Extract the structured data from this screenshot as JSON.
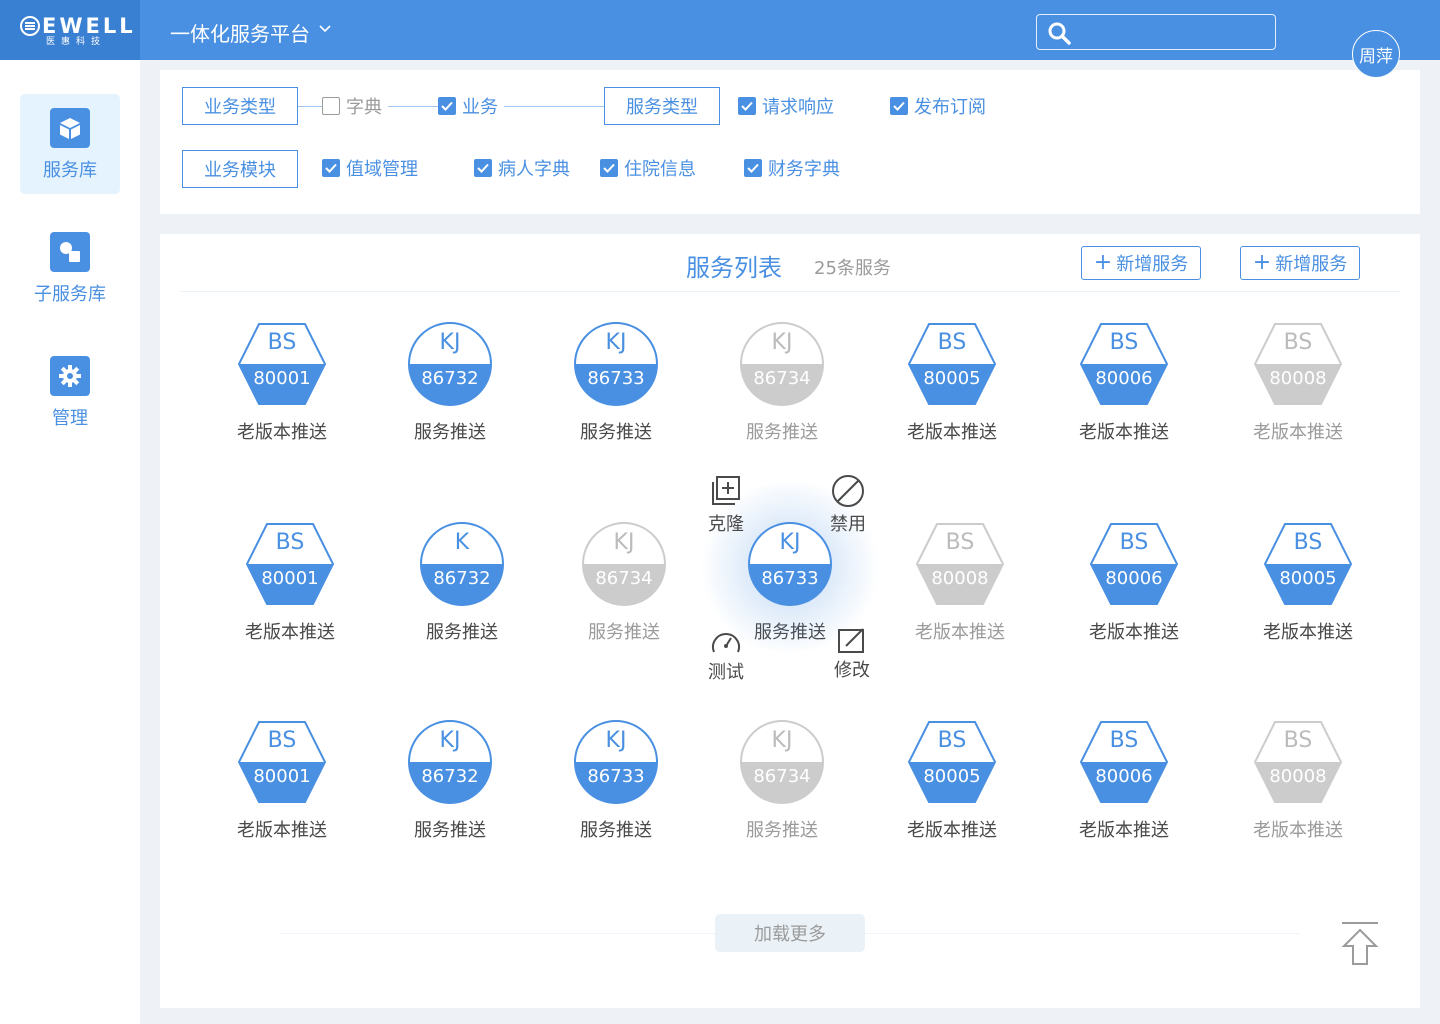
{
  "brand": {
    "logo_text": "EWELL",
    "logo_sub": "医惠科技",
    "color": "#4A90E2"
  },
  "header": {
    "title": "一体化服务平台",
    "user": "周萍"
  },
  "sidebar": {
    "items": [
      {
        "label": "服务库",
        "icon": "box-icon",
        "active": true
      },
      {
        "label": "子服务库",
        "icon": "shapes-icon",
        "active": false
      },
      {
        "label": "管理",
        "icon": "gear-icon",
        "active": false
      }
    ]
  },
  "filters": {
    "row1": {
      "tag1": "业务类型",
      "opt_dict": "字典",
      "opt_business": "业务",
      "tag2": "服务类型",
      "opt_request": "请求响应",
      "opt_publish": "发布订阅"
    },
    "row2": {
      "tag": "业务模块",
      "opt_domain": "值域管理",
      "opt_patient": "病人字典",
      "opt_inpatient": "住院信息",
      "opt_finance": "财务字典"
    }
  },
  "list": {
    "title": "服务列表",
    "count": "25条服务",
    "add_label_1": "新增服务",
    "add_label_2": "新增服务",
    "load_more": "加载更多"
  },
  "actions": {
    "clone": "克隆",
    "disable": "禁用",
    "test": "测试",
    "edit": "修改"
  },
  "services": [
    {
      "shape": "hex",
      "code": "BS",
      "num": "80001",
      "name": "老版本推送",
      "disabled": false
    },
    {
      "shape": "circle",
      "code": "KJ",
      "num": "86732",
      "name": "服务推送",
      "disabled": false
    },
    {
      "shape": "circle",
      "code": "KJ",
      "num": "86733",
      "name": "服务推送",
      "disabled": false
    },
    {
      "shape": "circle",
      "code": "KJ",
      "num": "86734",
      "name": "服务推送",
      "disabled": true
    },
    {
      "shape": "hex",
      "code": "BS",
      "num": "80005",
      "name": "老版本推送",
      "disabled": false
    },
    {
      "shape": "hex",
      "code": "BS",
      "num": "80006",
      "name": "老版本推送",
      "disabled": false
    },
    {
      "shape": "hex",
      "code": "BS",
      "num": "80008",
      "name": "老版本推送",
      "disabled": true
    },
    {
      "shape": "hex",
      "code": "BS",
      "num": "80001",
      "name": "老版本推送",
      "disabled": false
    },
    {
      "shape": "circle",
      "code": "K",
      "num": "86732",
      "name": "服务推送",
      "disabled": false
    },
    {
      "shape": "circle",
      "code": "KJ",
      "num": "86734",
      "name": "服务推送",
      "disabled": true
    },
    {
      "shape": "circle",
      "code": "KJ",
      "num": "86733",
      "name": "服务推送",
      "disabled": false,
      "selected": true
    },
    {
      "shape": "hex",
      "code": "BS",
      "num": "80008",
      "name": "老版本推送",
      "disabled": true
    },
    {
      "shape": "hex",
      "code": "BS",
      "num": "80006",
      "name": "老版本推送",
      "disabled": false
    },
    {
      "shape": "hex",
      "code": "BS",
      "num": "80005",
      "name": "老版本推送",
      "disabled": false
    },
    {
      "shape": "hex",
      "code": "BS",
      "num": "80001",
      "name": "老版本推送",
      "disabled": false
    },
    {
      "shape": "circle",
      "code": "KJ",
      "num": "86732",
      "name": "服务推送",
      "disabled": false
    },
    {
      "shape": "circle",
      "code": "KJ",
      "num": "86733",
      "name": "服务推送",
      "disabled": false
    },
    {
      "shape": "circle",
      "code": "KJ",
      "num": "86734",
      "name": "服务推送",
      "disabled": true
    },
    {
      "shape": "hex",
      "code": "BS",
      "num": "80005",
      "name": "老版本推送",
      "disabled": false
    },
    {
      "shape": "hex",
      "code": "BS",
      "num": "80006",
      "name": "老版本推送",
      "disabled": false
    },
    {
      "shape": "hex",
      "code": "BS",
      "num": "80008",
      "name": "老版本推送",
      "disabled": true
    }
  ],
  "colors": {
    "primary": "#4A90E2",
    "disabled": "#CCCCCC",
    "text": "#4A4A4A",
    "muted": "#9B9B9B",
    "active_bg": "#E5F3FF"
  }
}
